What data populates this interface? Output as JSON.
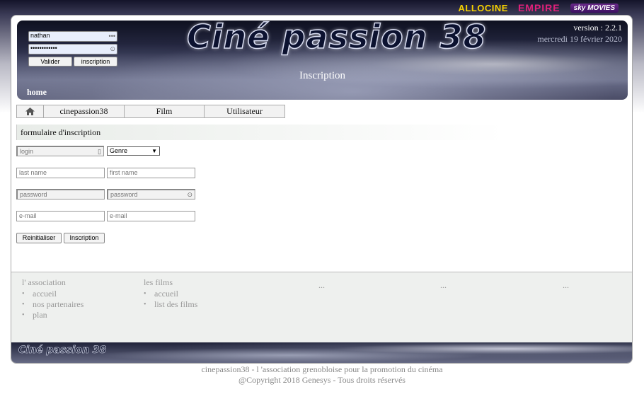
{
  "partners": {
    "allocine": "ALLOCINE",
    "empire": "EMPIRE",
    "sky": "sky MOVIES"
  },
  "login": {
    "username_value": "nathan",
    "password_value": "••••••••••••",
    "validate_label": "Valider",
    "register_label": "inscription"
  },
  "header": {
    "site_title": "Ciné passion 38",
    "version": "version : 2.2.1",
    "date": "mercredi 19 février 2020",
    "page_heading": "Inscription",
    "home_link": "home"
  },
  "menu": {
    "items": [
      "cinepassion38",
      "Film",
      "Utilisateur"
    ]
  },
  "form": {
    "heading": "formulaire d'inscription",
    "login_placeholder": "login",
    "genre_selected": "Genre",
    "last_name_placeholder": "last name",
    "first_name_placeholder": "first name",
    "password_placeholder": "password",
    "password_confirm_placeholder": "password",
    "email_placeholder": "e-mail",
    "email_confirm_placeholder": "e-mail",
    "reset_label": "Reinitialiser",
    "submit_label": "Inscription"
  },
  "footer": {
    "association": {
      "heading": "l' association",
      "items": [
        "accueil",
        "nos partenaires",
        "plan"
      ]
    },
    "films": {
      "heading": "les films",
      "items": [
        "accueil",
        "list des films"
      ]
    },
    "placeholders": [
      "...",
      "...",
      "..."
    ],
    "logo": "Ciné passion 38",
    "line1": "cinepassion38 - l 'association grenobloise pour la promotion du cinéma",
    "line2": "@Copyright 2018 Genesys - Tous droits réservés"
  }
}
